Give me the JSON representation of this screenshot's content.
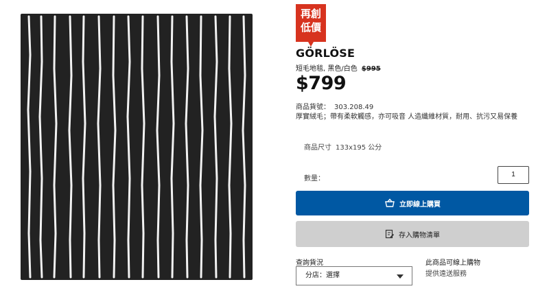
{
  "product": {
    "badge_line1": "再創",
    "badge_line2": "低價",
    "name": "GÖRLÖSE",
    "description": "短毛地毯, 黑色/白色",
    "old_price": "$995",
    "price": "$799",
    "article_label": "商品貨號：",
    "article_no": "303.208.49",
    "summary": "厚實絨毛；帶有柔軟觸感，亦可吸音 人造纖維材質，耐用、抗污又易保養",
    "size_label": "商品尺寸",
    "size_value": "133x195 公分"
  },
  "purchase": {
    "qty_label": "數量：",
    "qty_value": "1",
    "buy_label": "立即線上購買",
    "list_label": "存入購物清單"
  },
  "availability": {
    "stock_label": "查詢貨況",
    "store_placeholder": "分店：選擇",
    "online_title": "此商品可線上購物",
    "online_sub": "提供遠送服務"
  },
  "colors": {
    "badge": "#d7331f",
    "buy_button": "#0058a3",
    "list_button": "#cfcfcf",
    "rug": "#222222"
  },
  "icons": {
    "buy": "shopping-bag-icon",
    "list": "list-edit-icon",
    "store_select": "chevron-down-icon"
  }
}
